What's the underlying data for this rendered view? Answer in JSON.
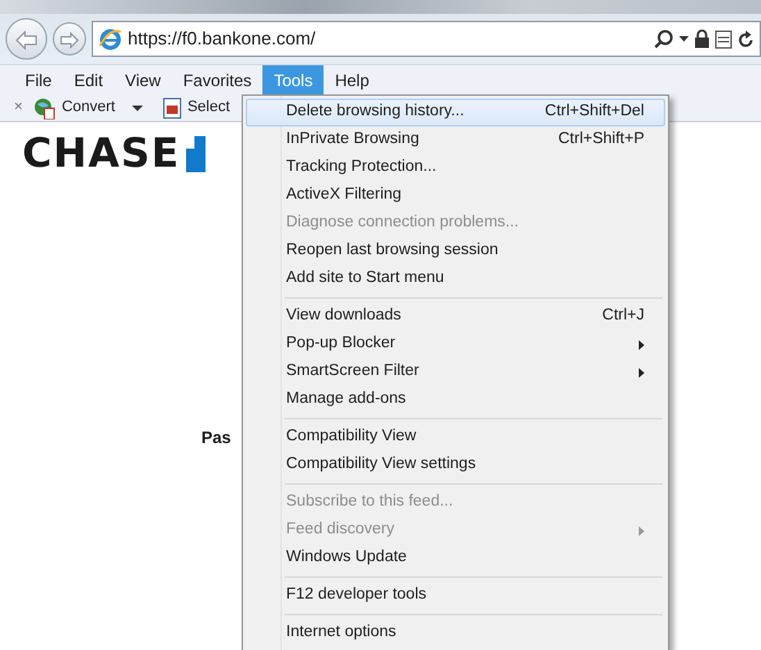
{
  "address_bar": {
    "url": "https://f0.bankone.com/"
  },
  "menu_bar": [
    {
      "label": "File",
      "selected": false
    },
    {
      "label": "Edit",
      "selected": false
    },
    {
      "label": "View",
      "selected": false
    },
    {
      "label": "Favorites",
      "selected": false
    },
    {
      "label": "Tools",
      "selected": true
    },
    {
      "label": "Help",
      "selected": false
    }
  ],
  "command_bar": {
    "close": "×",
    "items": [
      {
        "label": "Convert",
        "kind": "split"
      },
      {
        "label": "Select",
        "kind": "plain"
      }
    ]
  },
  "page": {
    "logo": "CHASE",
    "cut_text": "Pas"
  },
  "tools_menu": [
    [
      {
        "label": "Delete browsing history...",
        "shortcut": "Ctrl+Shift+Del",
        "submenu": false,
        "disabled": false,
        "selected": true
      },
      {
        "label": "InPrivate Browsing",
        "shortcut": "Ctrl+Shift+P",
        "submenu": false,
        "disabled": false,
        "selected": false
      },
      {
        "label": "Tracking Protection...",
        "submenu": false,
        "disabled": false,
        "selected": false
      },
      {
        "label": "ActiveX Filtering",
        "submenu": false,
        "disabled": false,
        "selected": false
      },
      {
        "label": "Diagnose connection problems...",
        "submenu": false,
        "disabled": true,
        "selected": false
      },
      {
        "label": "Reopen last browsing session",
        "submenu": false,
        "disabled": false,
        "selected": false
      },
      {
        "label": "Add site to Start menu",
        "submenu": false,
        "disabled": false,
        "selected": false
      }
    ],
    [
      {
        "label": "View downloads",
        "shortcut": "Ctrl+J",
        "submenu": false,
        "disabled": false,
        "selected": false
      },
      {
        "label": "Pop-up Blocker",
        "submenu": true,
        "disabled": false,
        "selected": false
      },
      {
        "label": "SmartScreen Filter",
        "submenu": true,
        "disabled": false,
        "selected": false
      },
      {
        "label": "Manage add-ons",
        "submenu": false,
        "disabled": false,
        "selected": false
      }
    ],
    [
      {
        "label": "Compatibility View",
        "submenu": false,
        "disabled": false,
        "selected": false
      },
      {
        "label": "Compatibility View settings",
        "submenu": false,
        "disabled": false,
        "selected": false
      }
    ],
    [
      {
        "label": "Subscribe to this feed...",
        "submenu": false,
        "disabled": true,
        "selected": false
      },
      {
        "label": "Feed discovery",
        "submenu": true,
        "disabled": true,
        "selected": false
      },
      {
        "label": "Windows Update",
        "submenu": false,
        "disabled": false,
        "selected": false
      }
    ],
    [
      {
        "label": "F12 developer tools",
        "submenu": false,
        "disabled": false,
        "selected": false
      }
    ],
    [
      {
        "label": "Internet options",
        "submenu": false,
        "disabled": false,
        "selected": false
      }
    ]
  ]
}
